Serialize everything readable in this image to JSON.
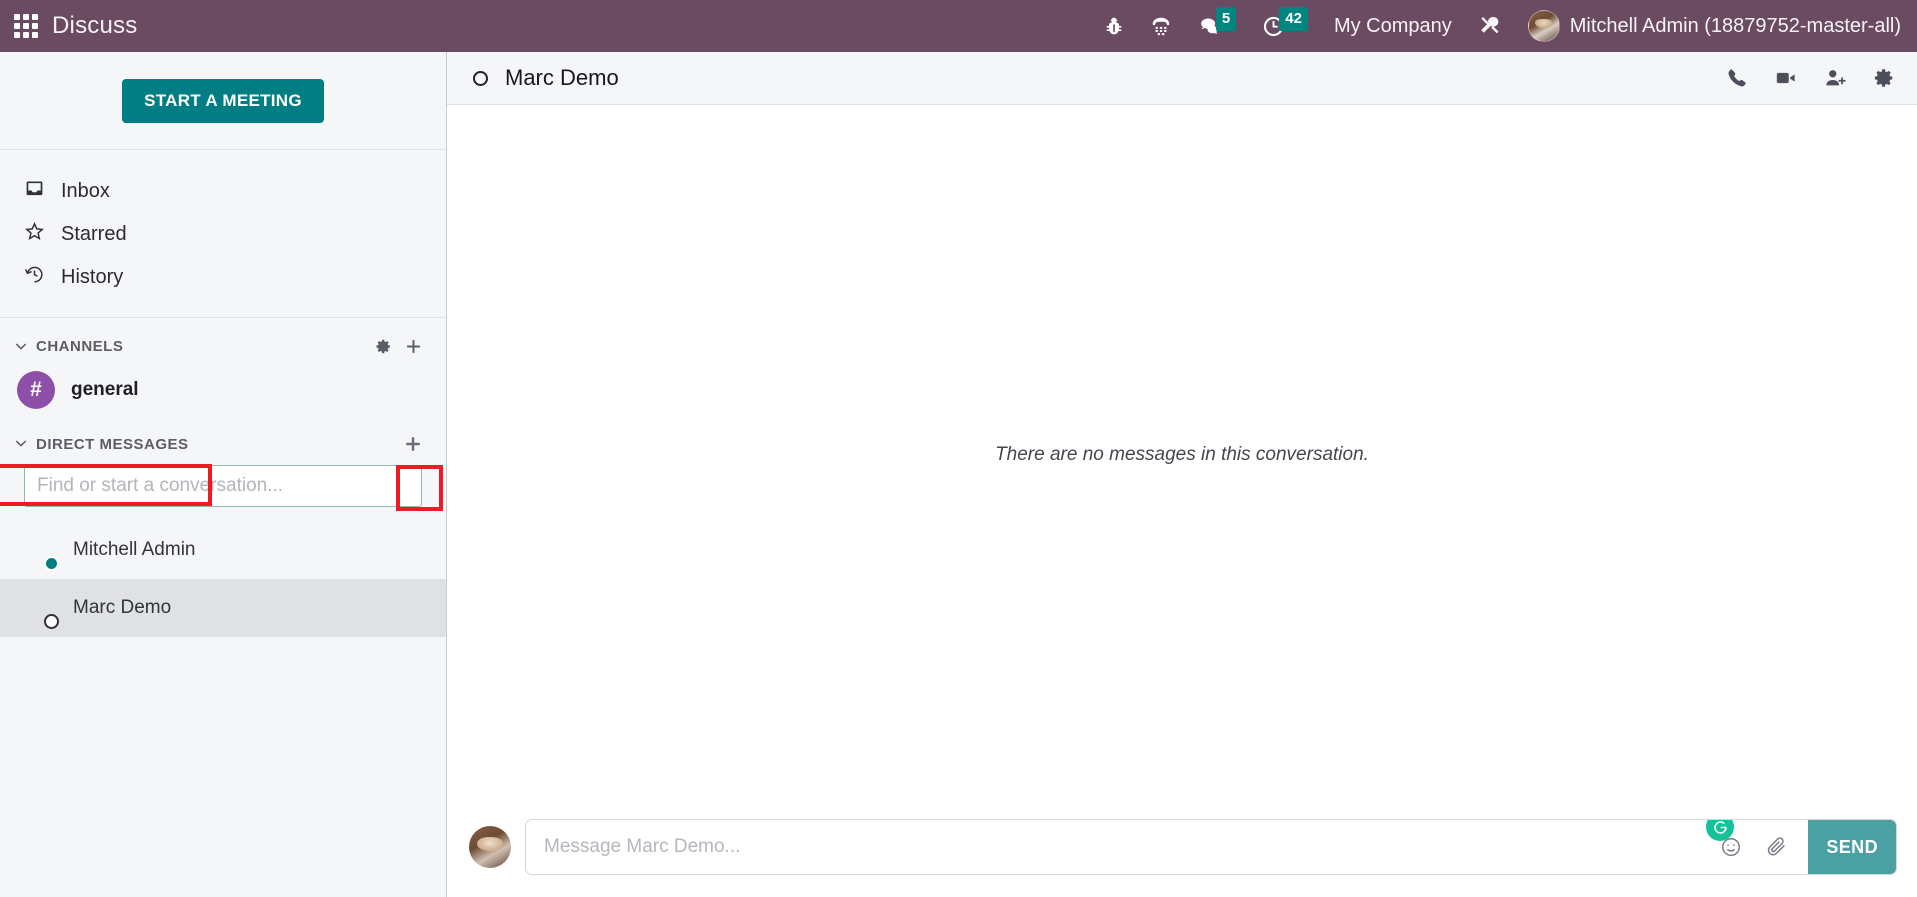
{
  "navbar": {
    "apps_icon": "apps-grid-icon",
    "brand": "Discuss",
    "icons": [
      {
        "name": "bug-icon",
        "label": "Bug"
      },
      {
        "name": "phone-dialpad-icon",
        "label": "Phone"
      }
    ],
    "messages": {
      "icon": "chat-bubble-icon",
      "badge": "5"
    },
    "activities": {
      "icon": "clock-icon",
      "badge": "42"
    },
    "company": "My Company",
    "settings_icon": "tools-icon",
    "user": "Mitchell Admin (18879752-master-all)"
  },
  "sidebar": {
    "start_meeting_label": "START A MEETING",
    "mailboxes": [
      {
        "label": "Inbox",
        "icon": "inbox-icon"
      },
      {
        "label": "Starred",
        "icon": "star-icon"
      },
      {
        "label": "History",
        "icon": "history-icon"
      }
    ],
    "channels_section": {
      "title": "CHANNELS",
      "settings_icon": "gear-icon",
      "add_icon": "plus-icon",
      "items": [
        {
          "name": "general",
          "avatar_glyph": "#",
          "avatar_color": "#8e4fa8"
        }
      ]
    },
    "direct_messages_section": {
      "title": "DIRECT MESSAGES",
      "add_icon": "plus-icon",
      "search_placeholder": "Find or start a conversation...",
      "search_value": "",
      "items": [
        {
          "name": "Mitchell Admin",
          "status": "online",
          "selected": false
        },
        {
          "name": "Marc Demo",
          "status": "offline",
          "selected": true
        }
      ]
    },
    "highlight_color": "#ec1c24"
  },
  "thread": {
    "title": "Marc Demo",
    "status": "offline",
    "actions": [
      {
        "name": "call-icon",
        "label": "Call"
      },
      {
        "name": "video-call-icon",
        "label": "Video Call"
      },
      {
        "name": "add-users-icon",
        "label": "Add Users"
      },
      {
        "name": "thread-settings-icon",
        "label": "Settings"
      }
    ],
    "empty_message": "There are no messages in this conversation."
  },
  "composer": {
    "placeholder": "Message Marc Demo...",
    "value": "",
    "grammarly_icon": "grammarly-icon",
    "emoji_icon": "emoji-smiley-icon",
    "attachment_icon": "paperclip-icon",
    "send_label": "SEND"
  },
  "colors": {
    "navbar": "#6b4b62",
    "accent_teal": "#017e84",
    "send_button": "#4aa0a2",
    "badge": "#00867e",
    "channel_purple": "#8e4fa8",
    "grammarly_green": "#15c39a",
    "highlight_red": "#ec1c24"
  }
}
